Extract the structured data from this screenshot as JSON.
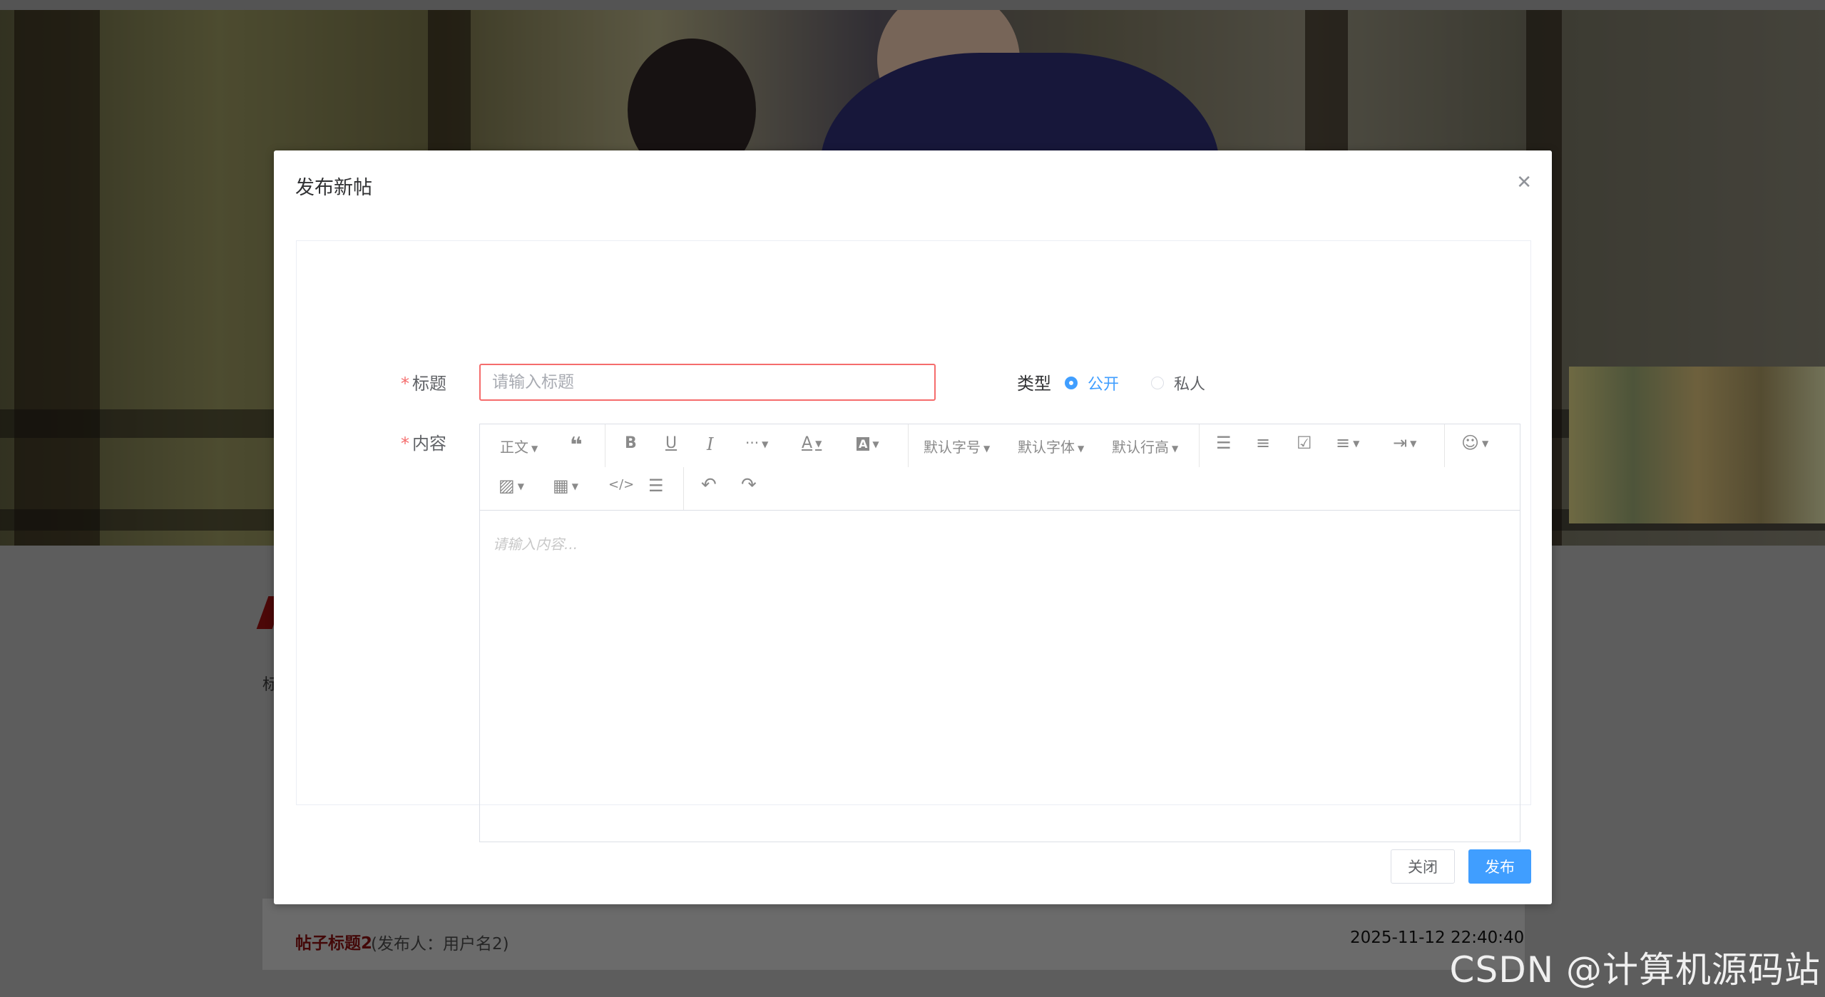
{
  "background": {
    "post": {
      "title": "帖子标题2",
      "meta": "(发布人：用户名2)",
      "time": "2025-11-12 22:40:40"
    },
    "fragment_text": "标"
  },
  "dialog": {
    "title": "发布新帖",
    "close_icon": "close-icon",
    "form": {
      "title_label": "标题",
      "title_placeholder": "请输入标题",
      "type_label": "类型",
      "type_options": [
        "公开",
        "私人"
      ],
      "type_selected": "公开",
      "content_label": "内容",
      "content_placeholder": "请输入内容..."
    },
    "toolbar": {
      "heading": "正文",
      "quote_icon": "quote-icon",
      "bold": "B",
      "underline": "U",
      "italic": "I",
      "more": "···",
      "font_color": "A",
      "bg_color": "A",
      "font_size": "默认字号",
      "font_family": "默认字体",
      "line_height": "默认行高",
      "bullet_list_icon": "bullet-list-icon",
      "numbered_list_icon": "numbered-list-icon",
      "todo_icon": "todo-icon",
      "align_icon": "align-icon",
      "indent_icon": "indent-icon",
      "emoji_icon": "emoji-icon",
      "image_icon": "image-icon",
      "table_icon": "table-icon",
      "code_icon": "code-icon",
      "divider_icon": "divider-icon",
      "undo_icon": "undo-icon",
      "redo_icon": "redo-icon"
    },
    "buttons": {
      "close": "关闭",
      "publish": "发布"
    }
  },
  "watermark": "CSDN @计算机源码站",
  "colors": {
    "primary": "#409eff",
    "error": "#f56c6c",
    "post_title": "#7a1010"
  }
}
